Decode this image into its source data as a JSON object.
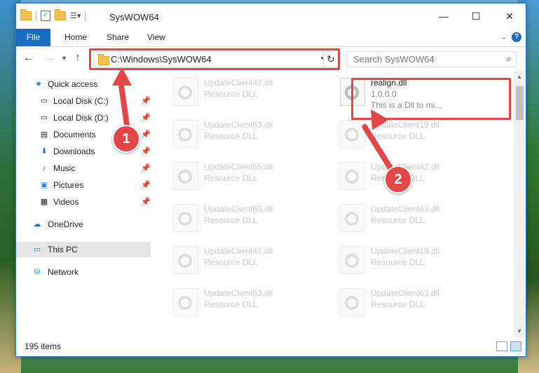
{
  "window": {
    "title": "SysWOW64"
  },
  "window_controls": {
    "minimize": "—",
    "maximize": "☐",
    "close": "✕"
  },
  "menu": {
    "file": "File",
    "home": "Home",
    "share": "Share",
    "view": "View"
  },
  "address": {
    "path": "C:\\Windows\\SysWOW64"
  },
  "search": {
    "placeholder": "Search SysWOW64"
  },
  "sidebar": {
    "items": [
      {
        "label": "Quick access",
        "icon": "star-icon"
      },
      {
        "label": "Local Disk (C:)",
        "icon": "drive-icon",
        "pinned": true
      },
      {
        "label": "Local Disk (D:)",
        "icon": "drive-icon",
        "pinned": true
      },
      {
        "label": "Documents",
        "icon": "documents-icon",
        "pinned": true
      },
      {
        "label": "Downloads",
        "icon": "download-icon",
        "pinned": true
      },
      {
        "label": "Music",
        "icon": "music-icon",
        "pinned": true
      },
      {
        "label": "Pictures",
        "icon": "pictures-icon",
        "pinned": true
      },
      {
        "label": "Videos",
        "icon": "videos-icon",
        "pinned": true
      },
      {
        "label": "OneDrive",
        "icon": "cloud-icon"
      },
      {
        "label": "This PC",
        "icon": "pc-icon",
        "selected": true
      },
      {
        "label": "Network",
        "icon": "network-icon"
      }
    ]
  },
  "files": {
    "highlighted": {
      "name": "realign.dll",
      "version": "1.0.0.0",
      "description": "This is a Dll to mi..."
    },
    "left_column": [
      {
        "name": "UpdateClient42.dll",
        "type": "Resource DLL"
      },
      {
        "name": "UpdateClient63.dll",
        "type": "Resource DLL"
      },
      {
        "name": "UpdateClient65.dll",
        "type": "Resource DLL"
      },
      {
        "name": "UpdateClient63.dll",
        "type": "Resource DLL"
      },
      {
        "name": "UpdateClient42.dll",
        "type": "Resource DLL"
      },
      {
        "name": "UpdateClient63.dll",
        "type": "Resource DLL"
      }
    ],
    "right_column": [
      {
        "name": "UpdateClient19.dll",
        "type": "Resource DLL"
      },
      {
        "name": "UpdateClient42.dll",
        "type": "Resource DLL"
      },
      {
        "name": "UpdateClient63.dll",
        "type": "Resource DLL"
      },
      {
        "name": "UpdateClient19.dll",
        "type": "Resource DLL"
      },
      {
        "name": "UpdateClient63.dll",
        "type": "Resource DLL"
      }
    ]
  },
  "status": {
    "item_count": "195 items"
  },
  "annotations": {
    "step1": "1",
    "step2": "2",
    "color": "#e24646"
  }
}
